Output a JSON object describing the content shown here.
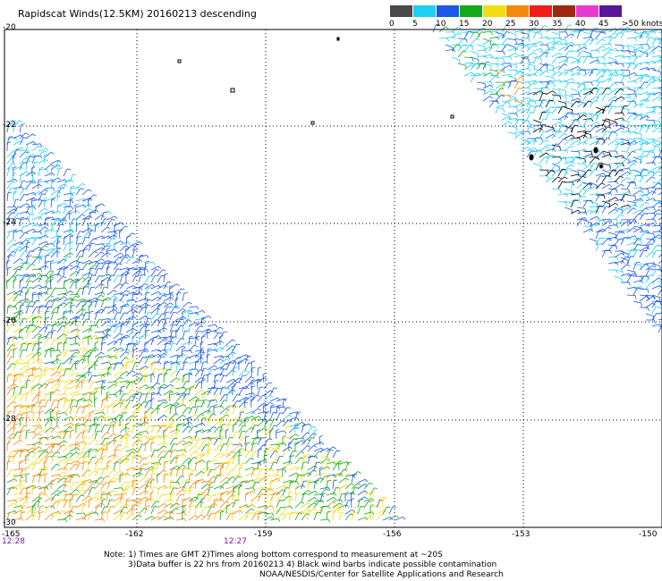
{
  "title": "Rapidscat Winds(12.5KM) 20160213 descending",
  "legend": {
    "labels": [
      "0",
      "5",
      "10",
      "15",
      "20",
      "25",
      "30",
      "35",
      "40",
      "45",
      ">50 knots"
    ],
    "colors": [
      "#4a4a4a",
      "#1fd0f4",
      "#1d58e6",
      "#16a81b",
      "#f2dd13",
      "#f38a0d",
      "#f01d1d",
      "#9d2a10",
      "#e83ad2",
      "#5a1696"
    ]
  },
  "axes": {
    "y_labels": [
      "-20",
      "-22",
      "-24",
      "-26",
      "-28",
      "-30"
    ],
    "x_labels": [
      "-165",
      "-162",
      "-159",
      "-156",
      "-153",
      "-150"
    ],
    "time_labels": [
      "12:28",
      "12:27"
    ]
  },
  "notes": [
    "Note: 1) Times are GMT 2)Times along bottom correspond to measurement at ~20S",
    "3)Data buffer is 22 hrs from 20160213 4) Black wind barbs indicate possible contamination",
    "NOAA/NESDIS/Center for Satellite Applications and Research"
  ]
}
